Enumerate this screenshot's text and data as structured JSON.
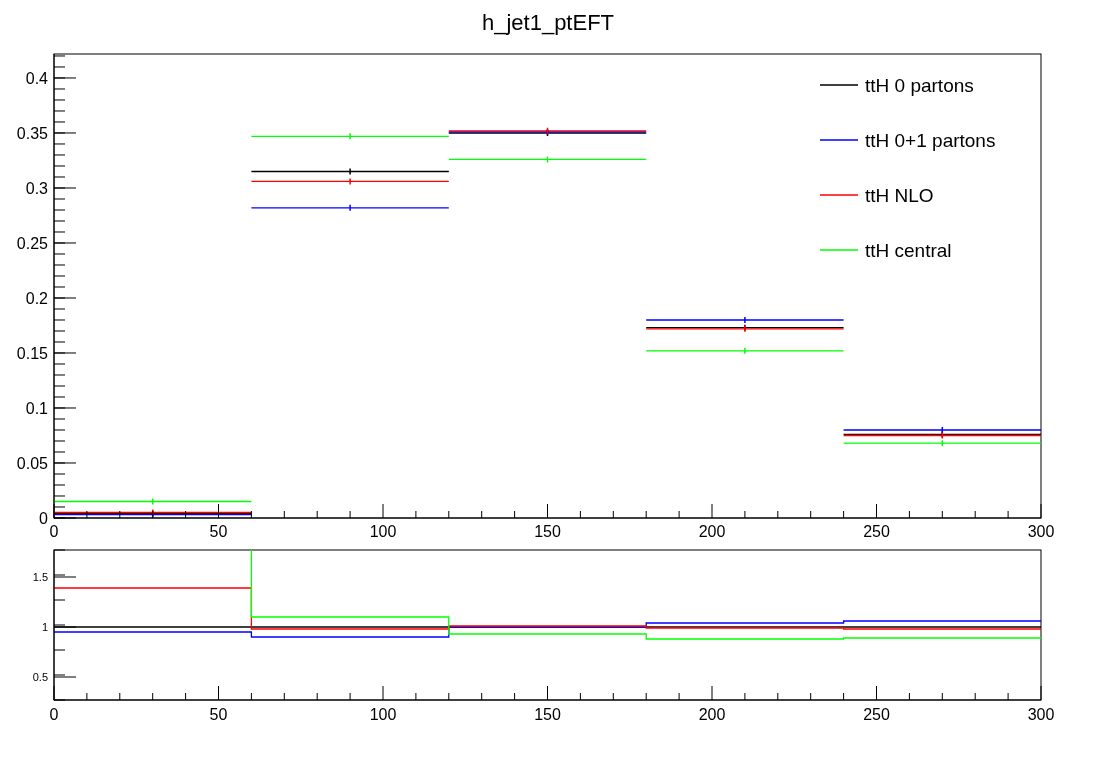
{
  "main_plot": {
    "chart_data": {
      "type": "line",
      "title": "h_jet1_ptEFT",
      "x": [
        0,
        60,
        60,
        120,
        120,
        180,
        180,
        240,
        240,
        300
      ],
      "xlim": [
        0,
        300
      ],
      "ylim": [
        0,
        0.4218
      ],
      "xticks": [
        0,
        50,
        100,
        150,
        200,
        250,
        300
      ],
      "yticks": [
        0,
        0.05,
        0.1,
        0.15,
        0.2,
        0.25,
        0.3,
        0.35,
        0.4
      ],
      "legend": "upper right",
      "series": [
        {
          "name": "ttH 0 partons",
          "color": "#000000",
          "values": [
            0.004,
            0.004,
            0.315,
            0.315,
            0.35,
            0.35,
            0.173,
            0.173,
            0.076,
            0.076
          ]
        },
        {
          "name": "ttH 0+1 partons",
          "color": "#0000ff",
          "values": [
            0.003,
            0.003,
            0.282,
            0.282,
            0.351,
            0.351,
            0.18,
            0.18,
            0.08,
            0.08
          ]
        },
        {
          "name": "ttH NLO",
          "color": "#ff0000",
          "values": [
            0.005,
            0.005,
            0.306,
            0.306,
            0.352,
            0.352,
            0.172,
            0.172,
            0.075,
            0.075
          ]
        },
        {
          "name": "ttH central",
          "color": "#00ff00",
          "values": [
            0.015,
            0.015,
            0.347,
            0.347,
            0.326,
            0.326,
            0.152,
            0.152,
            0.068,
            0.068
          ]
        }
      ]
    }
  },
  "ratio_plot": {
    "chart_data": {
      "type": "line",
      "x": [
        0,
        60,
        60,
        120,
        120,
        180,
        180,
        240,
        240,
        300
      ],
      "xlim": [
        0,
        300
      ],
      "ylim": [
        0.27,
        1.77
      ],
      "xticks": [
        0,
        50,
        100,
        150,
        200,
        250,
        300
      ],
      "yticks": [
        0.5,
        1,
        1.5
      ],
      "series": [
        {
          "color": "#000000",
          "values": [
            1,
            1,
            1,
            1,
            1,
            1,
            1,
            1,
            1,
            1
          ]
        },
        {
          "color": "#0000ff",
          "values": [
            0.95,
            0.95,
            0.9,
            0.9,
            1.0,
            1.0,
            1.04,
            1.04,
            1.06,
            1.06
          ]
        },
        {
          "color": "#ff0000",
          "values": [
            1.39,
            1.39,
            0.98,
            0.98,
            1.01,
            1.01,
            0.99,
            0.99,
            0.98,
            0.98
          ]
        },
        {
          "color": "#00ff00",
          "values": [
            null,
            1.77,
            1.1,
            1.1,
            0.93,
            0.93,
            0.88,
            0.88,
            0.89,
            0.89
          ]
        }
      ]
    }
  }
}
